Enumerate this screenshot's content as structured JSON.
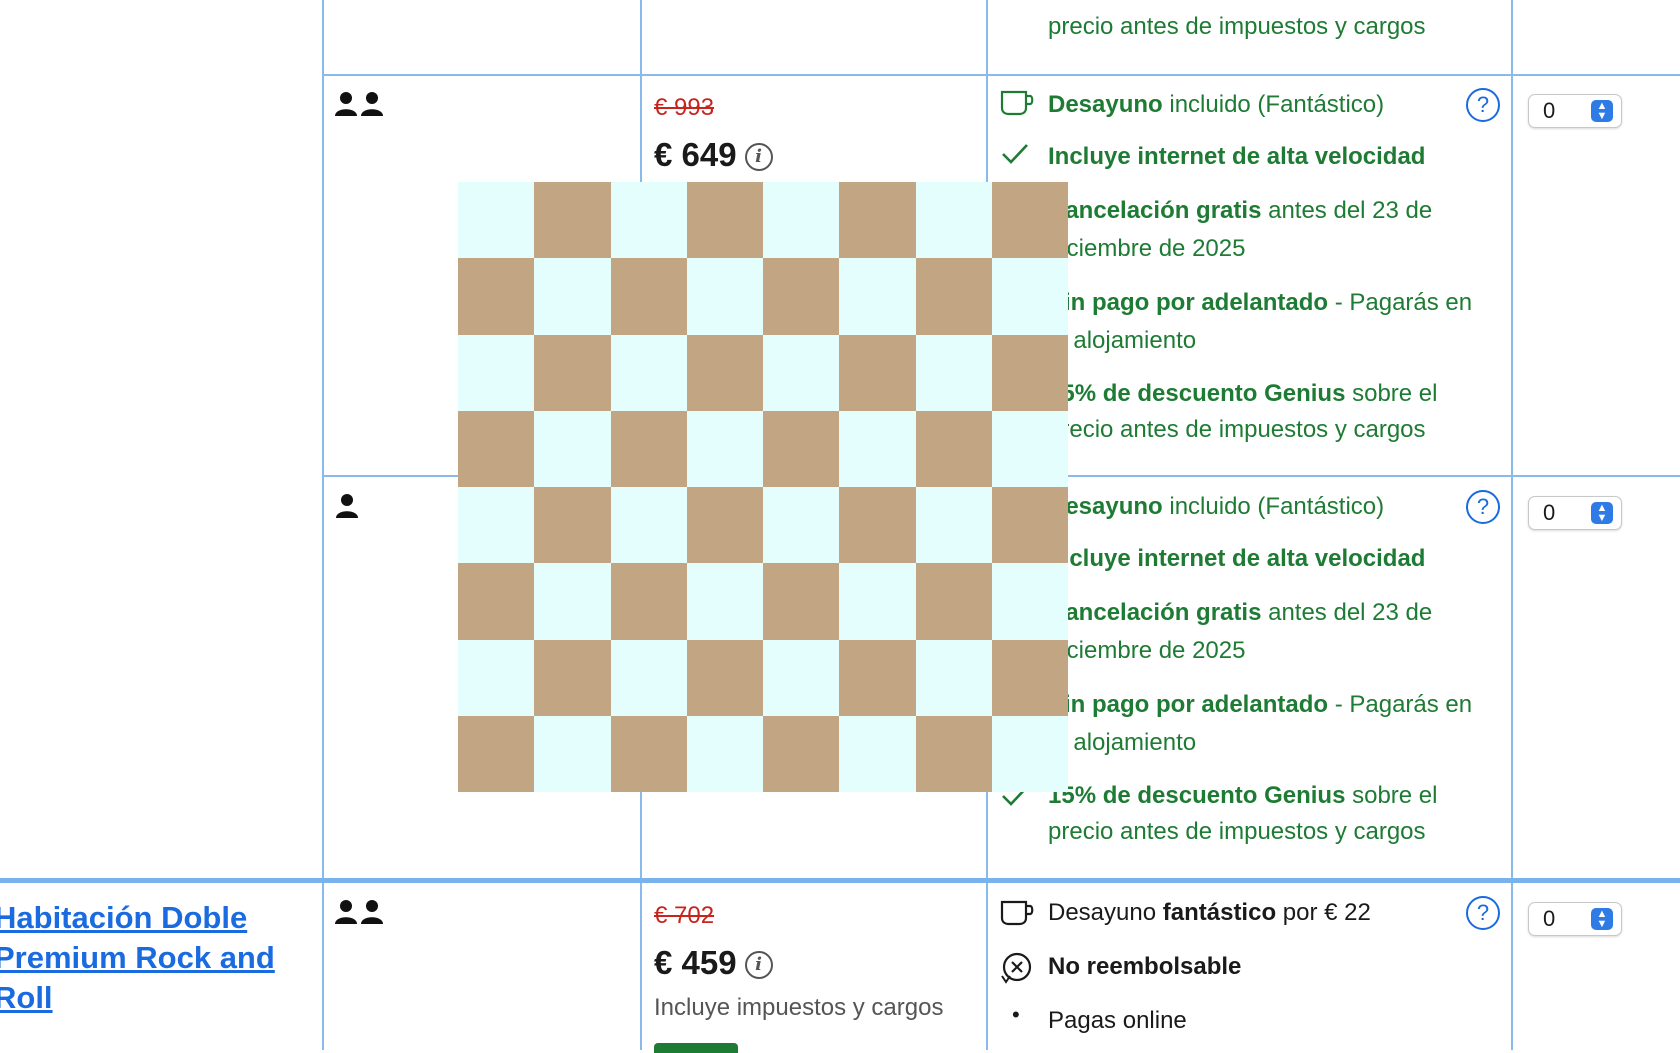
{
  "rows": [
    {
      "id": "top",
      "conditions_partial": [
        "precio antes de impuestos y cargos"
      ]
    },
    {
      "id": "row-2",
      "guest_icon": "two-persons-icon",
      "old_price": "€ 993",
      "price": "€ 649",
      "conditions": [
        {
          "icon": "cup-icon",
          "bold": "Desayuno",
          "rest": " incluido (Fantástico)"
        },
        {
          "icon": "check-icon",
          "bold": "Incluye internet de alta velocidad",
          "rest": ""
        },
        {
          "icon": "check-icon",
          "bold": "Cancelación gratis",
          "rest": " antes del 23 de diciembre de 2025"
        },
        {
          "icon": "check-icon",
          "bold": "Sin pago por adelantado",
          "rest": " - Pagarás en el alojamiento"
        },
        {
          "icon": "check-icon",
          "bold": "15% de descuento Genius",
          "rest": " sobre el precio antes de impuestos y cargos"
        }
      ],
      "quantity": "0"
    },
    {
      "id": "row-3",
      "guest_icon": "one-person-icon",
      "conditions": [
        {
          "icon": "cup-icon",
          "bold": "Desayuno",
          "rest": " incluido (Fantástico)"
        },
        {
          "icon": "check-icon",
          "bold": "Incluye internet de alta velocidad",
          "rest": ""
        },
        {
          "icon": "check-icon",
          "bold": "Cancelación gratis",
          "rest": " antes del 23 de diciembre de 2025"
        },
        {
          "icon": "check-icon",
          "bold": "Sin pago por adelantado",
          "rest": " - Pagarás en el alojamiento"
        },
        {
          "icon": "check-icon",
          "bold": "15% de descuento Genius",
          "rest": " sobre el precio antes de impuestos y cargos"
        }
      ],
      "quantity": "0"
    },
    {
      "id": "row-4",
      "room_name": "Habitación Doble Premium Rock and Roll",
      "guest_icon": "two-persons-icon",
      "old_price": "€ 702",
      "price": "€ 459",
      "taxes_note": "Incluye impuestos y cargos",
      "breakfast": {
        "pre": "Desayuno ",
        "bold": "fantástico",
        "post": " por € 22"
      },
      "non_refundable": "No reembolsable",
      "pay_online": "Pagas online",
      "quantity": "0"
    }
  ],
  "overlay": {
    "type": "checkerboard",
    "size": 8,
    "light_color": "#e3fefd",
    "dark_color": "#c2a683"
  },
  "colors": {
    "link": "#1a6be0",
    "green": "#1e7b34",
    "strike": "#c8241e",
    "grid": "#8ab9ec"
  }
}
